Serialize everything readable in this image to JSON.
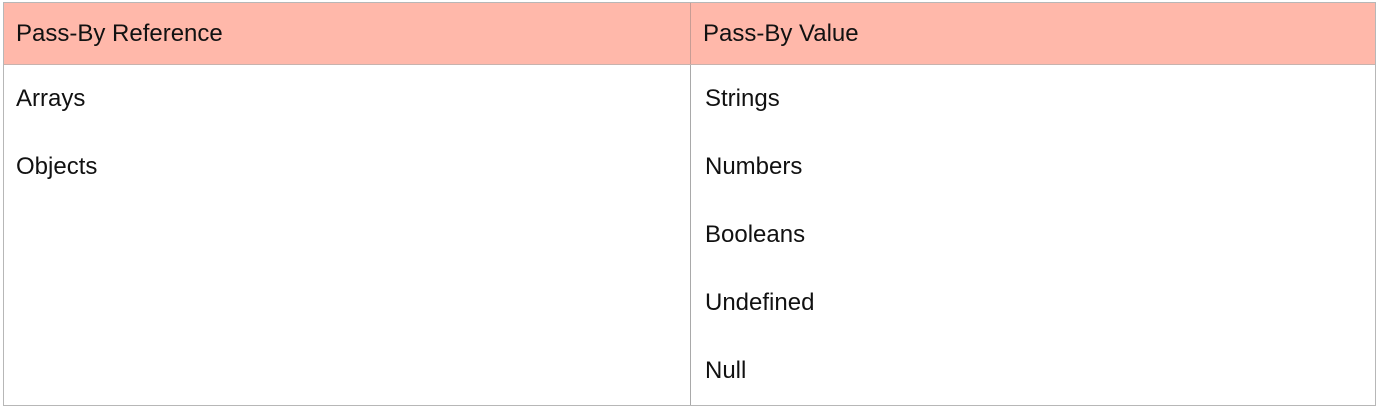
{
  "table": {
    "headers": [
      "Pass-By Reference",
      "Pass-By Value"
    ],
    "columns": {
      "reference": [
        "Arrays",
        "Objects"
      ],
      "value": [
        "Strings",
        "Numbers",
        "Booleans",
        "Undefined",
        "Null"
      ]
    }
  },
  "colors": {
    "header_background": "#ffb8aa",
    "border": "#b7b7b7",
    "text": "#111111"
  }
}
